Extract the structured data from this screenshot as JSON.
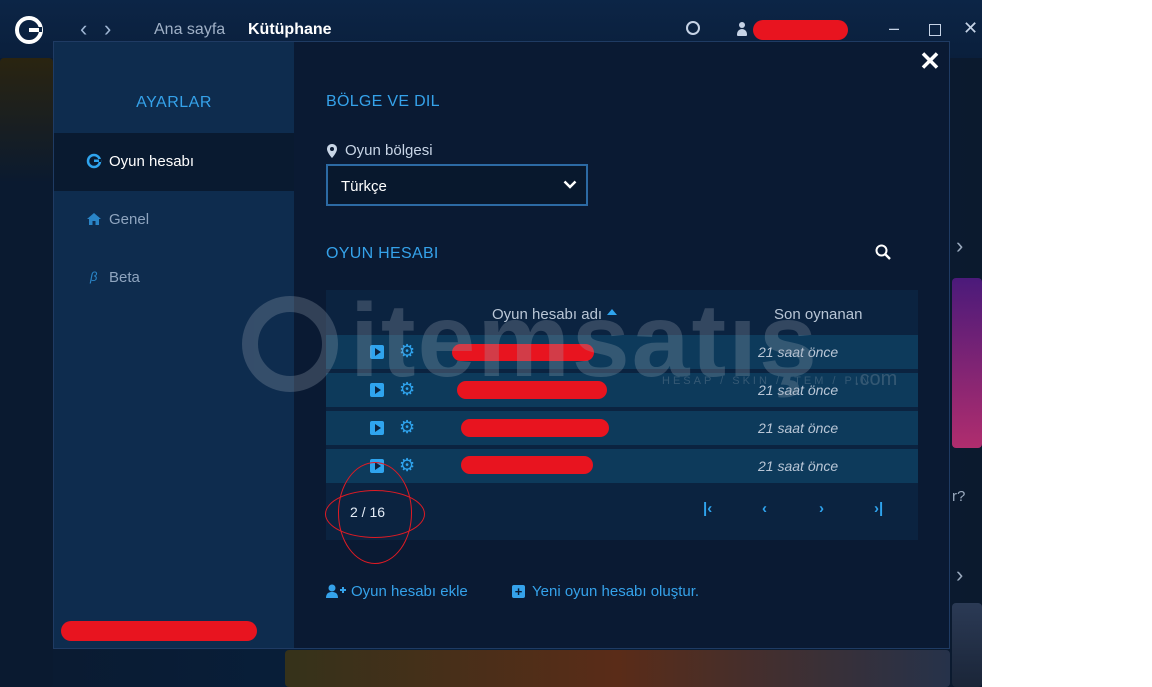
{
  "titlebar": {
    "nav_home": "Ana sayfa",
    "nav_library": "Kütüphane",
    "icons": [
      "logo-icon",
      "back-icon",
      "forward-icon",
      "globe-icon",
      "user-icon",
      "minimize-icon",
      "maximize-icon",
      "close-icon"
    ]
  },
  "sidebar": {
    "title": "AYARLAR",
    "items": [
      {
        "label": "Oyun hesabı",
        "icon": "game-logo-icon",
        "active": true
      },
      {
        "label": "Genel",
        "icon": "home-icon",
        "active": false
      },
      {
        "label": "Beta",
        "icon": "beta-icon",
        "active": false
      }
    ]
  },
  "region_section": {
    "title": "BÖLGE VE DIL",
    "field_label": "Oyun bölgesi",
    "selected": "Türkçe"
  },
  "accounts_section": {
    "title": "OYUN HESABI",
    "columns": {
      "name": "Oyun hesabı adı",
      "last_played": "Son oynanan"
    },
    "rows": [
      {
        "last_played": "21 saat önce"
      },
      {
        "last_played": "21 saat önce"
      },
      {
        "last_played": "21 saat önce"
      },
      {
        "last_played": "21 saat önce"
      }
    ],
    "pager": "2 / 16"
  },
  "actions": {
    "add_account": "Oyun hesabı ekle",
    "create_account": "Yeni oyun hesabı oluştur."
  },
  "watermark": {
    "word": "itemsatış",
    "sub": "HESAP / SKIN / ITEM / PIN",
    "com": ".com"
  },
  "background": {
    "side_text": "r?"
  },
  "colors": {
    "accent": "#35a2ea",
    "redaction": "#e8141f",
    "modal_bg": "#0a1a33",
    "sidebar_bg": "#0e2c4e"
  }
}
